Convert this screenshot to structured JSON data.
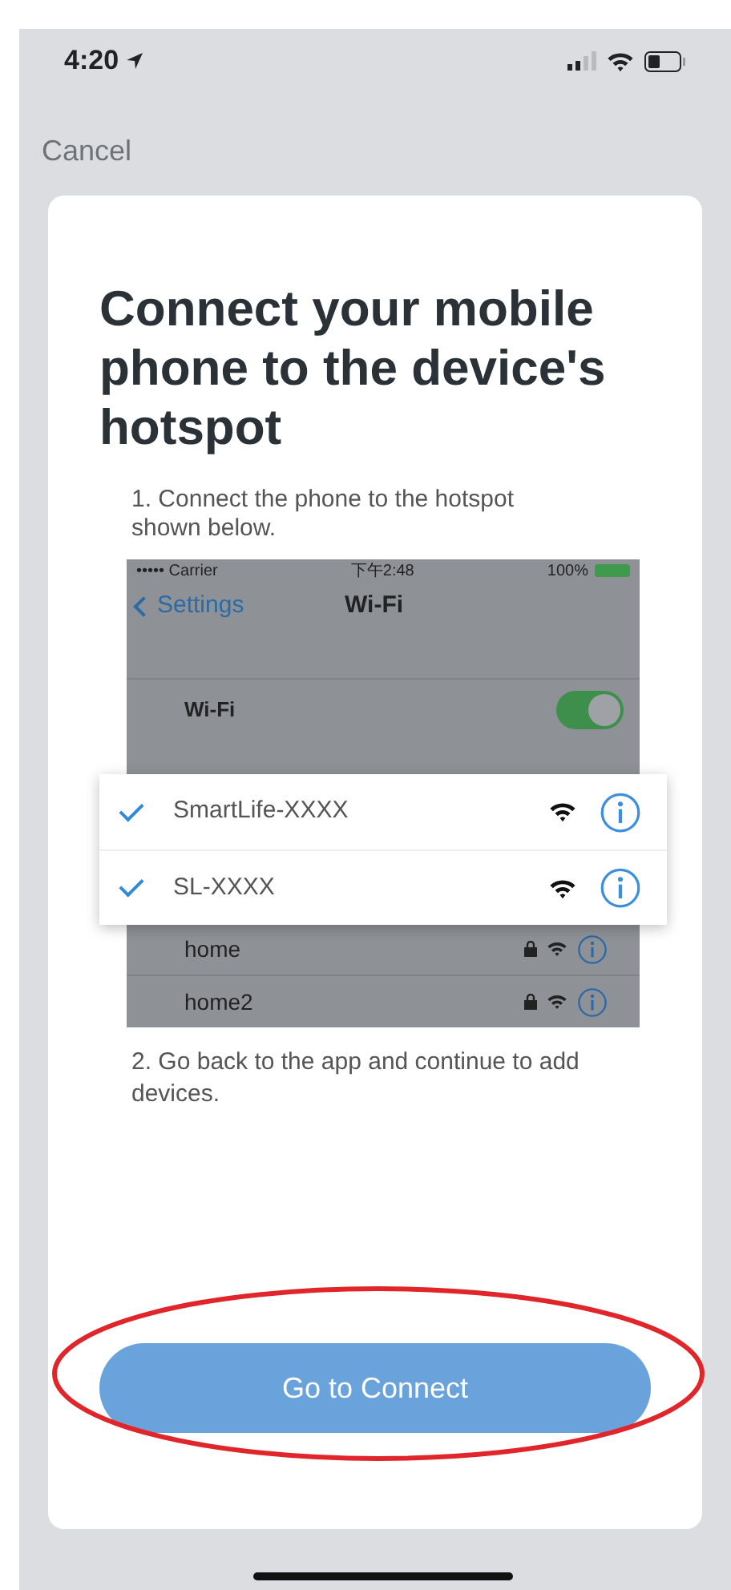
{
  "status_bar": {
    "time": "4:20"
  },
  "nav": {
    "cancel": "Cancel"
  },
  "title": "Connect your mobile phone to the device's hotspot",
  "steps": [
    "1. Connect the phone to the hotspot shown below.",
    "2. Go back to the app and continue to add devices."
  ],
  "illustration": {
    "status": {
      "carrier": "••••• Carrier",
      "time": "下午2:48",
      "battery": "100%"
    },
    "back": "Settings",
    "title": "Wi-Fi",
    "wifi_row": {
      "label": "Wi-Fi",
      "on": true
    },
    "hotspots": [
      {
        "name": "SmartLife-XXXX",
        "checked": true
      },
      {
        "name": "SL-XXXX",
        "checked": true
      }
    ],
    "networks": [
      {
        "name": "home",
        "locked": true
      },
      {
        "name": "home2",
        "locked": true
      }
    ]
  },
  "button": {
    "label": "Go to Connect",
    "highlighted": true
  }
}
